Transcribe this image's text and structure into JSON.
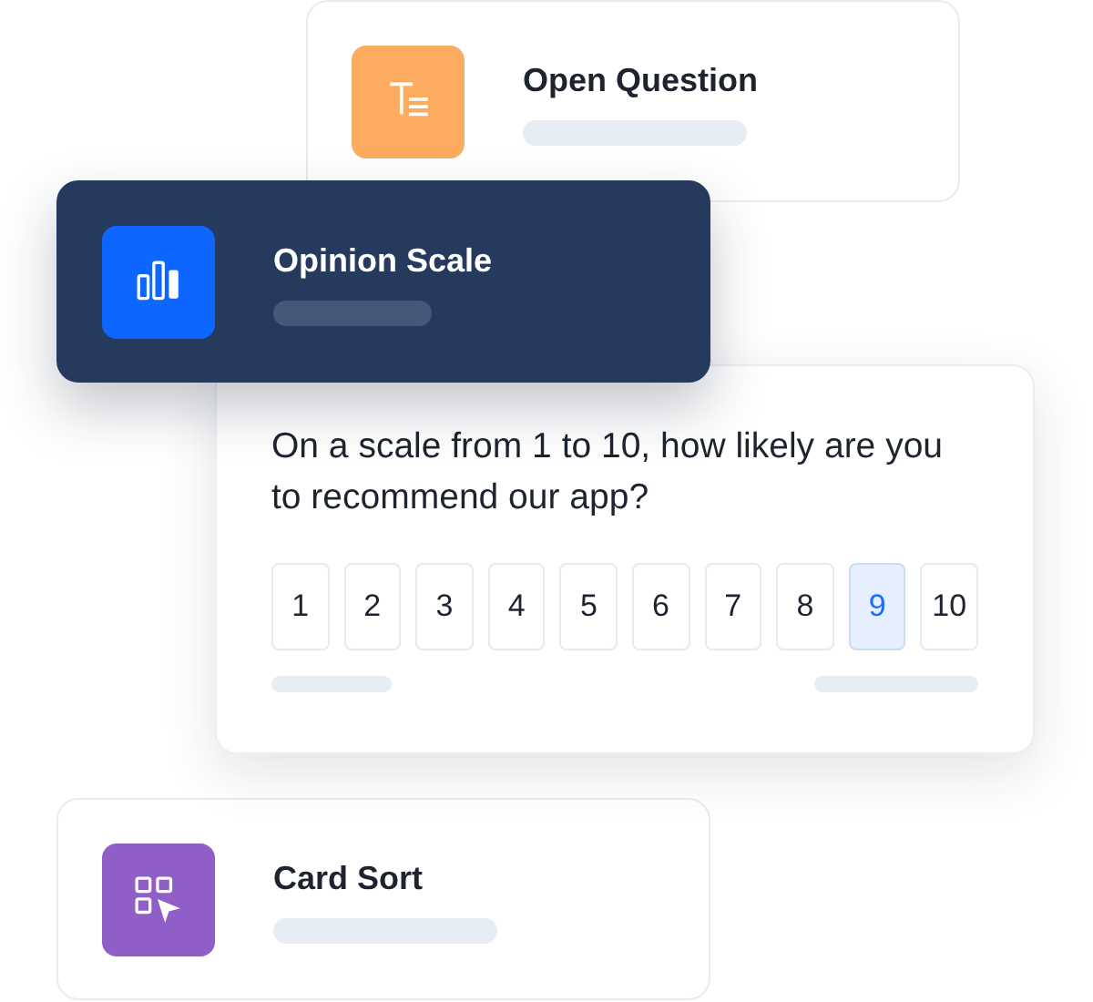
{
  "question_types": [
    {
      "kind": "open-question",
      "title": "Open Question",
      "color": "#fdab5f",
      "selected": false
    },
    {
      "kind": "opinion-scale",
      "title": "Opinion Scale",
      "color": "#0d66ff",
      "selected": true
    },
    {
      "kind": "card-sort",
      "title": "Card Sort",
      "color": "#8f5fc7",
      "selected": false
    }
  ],
  "question": {
    "text": "On a scale from 1 to 10, how likely are you to recommend our app?",
    "options": [
      {
        "label": "1",
        "selected": false
      },
      {
        "label": "2",
        "selected": false
      },
      {
        "label": "3",
        "selected": false
      },
      {
        "label": "4",
        "selected": false
      },
      {
        "label": "5",
        "selected": false
      },
      {
        "label": "6",
        "selected": false
      },
      {
        "label": "7",
        "selected": false
      },
      {
        "label": "8",
        "selected": false
      },
      {
        "label": "9",
        "selected": true
      },
      {
        "label": "10",
        "selected": false
      }
    ]
  }
}
